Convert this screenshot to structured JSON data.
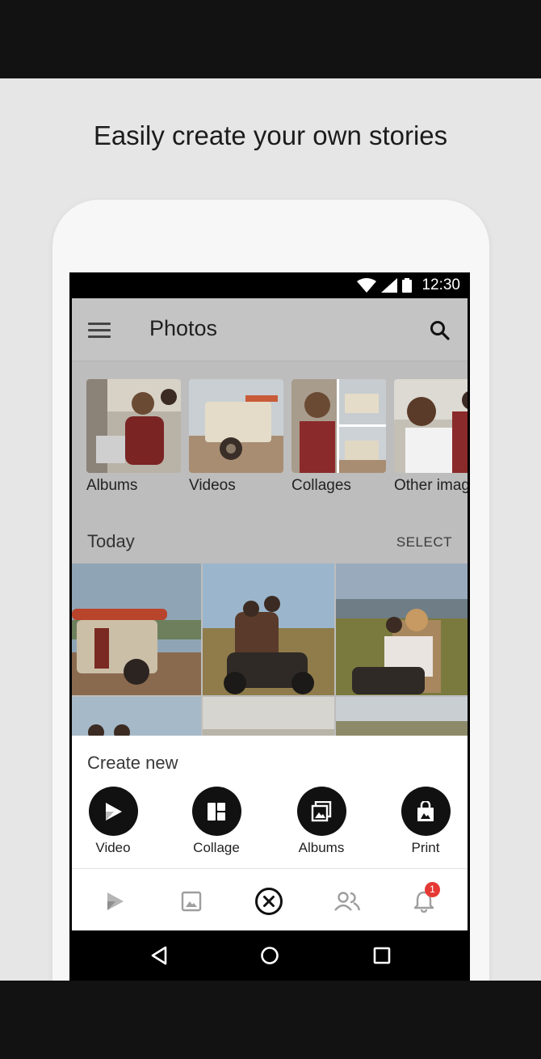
{
  "headline": "Easily create your own stories",
  "status_bar": {
    "time": "12:30"
  },
  "app_bar": {
    "title": "Photos"
  },
  "categories": [
    {
      "label": "Albums"
    },
    {
      "label": "Videos"
    },
    {
      "label": "Collages"
    },
    {
      "label": "Other imag"
    }
  ],
  "section": {
    "title": "Today",
    "select_label": "SELECT"
  },
  "create_sheet": {
    "title": "Create new",
    "items": [
      {
        "label": "Video",
        "icon": "video-play-icon"
      },
      {
        "label": "Collage",
        "icon": "collage-icon"
      },
      {
        "label": "Albums",
        "icon": "albums-icon"
      },
      {
        "label": "Print",
        "icon": "print-bag-icon"
      }
    ]
  },
  "bottom_nav": {
    "items": [
      {
        "icon": "video-play-icon"
      },
      {
        "icon": "image-icon"
      },
      {
        "icon": "close-circle-icon"
      },
      {
        "icon": "people-icon"
      },
      {
        "icon": "bell-icon",
        "badge": "1"
      }
    ]
  },
  "colors": {
    "badge": "#e53935",
    "scrim": "#bdbdbd",
    "sheet": "#ffffff"
  }
}
